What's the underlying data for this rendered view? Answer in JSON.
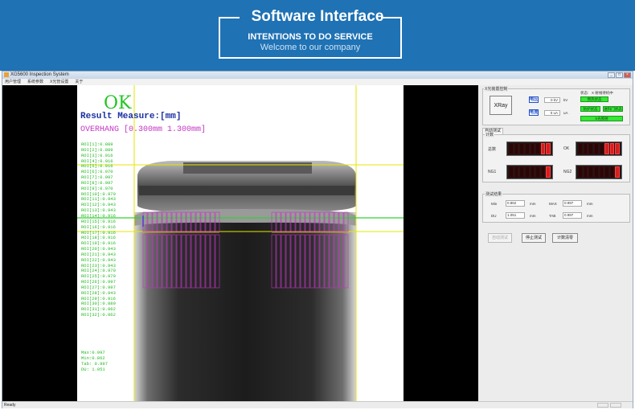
{
  "banner": {
    "title": "Software Interface",
    "subtitle": "INTENTIONS TO DO SERVICE",
    "welcome": "Welcome to our company"
  },
  "window": {
    "title": "XG5600 Inspection System",
    "menu": [
      "用户管理",
      "系统参数",
      "X光管设置",
      "关于"
    ]
  },
  "overlay": {
    "result_status": "OK",
    "result_measure": "Result Measure:[mm]",
    "overhang": "OVERHANG [0.300mm  1.300mm]",
    "measurements": [
      "ROI[1]:0.889",
      "ROI[2]:0.889",
      "ROI[3]:0.916",
      "ROI[4]:0.916",
      "ROI[5]:0.916",
      "ROI[6]:0.970",
      "ROI[7]:0.997",
      "ROI[8]:0.997",
      "ROI[9]:0.970",
      "ROI[10]:0.970",
      "ROI[11]:0.943",
      "ROI[12]:0.943",
      "ROI[13]:0.943",
      "ROI[14]:0.916",
      "ROI[15]:0.916",
      "ROI[16]:0.916",
      "ROI[17]:0.916",
      "ROI[18]:0.916",
      "ROI[19]:0.916",
      "ROI[20]:0.943",
      "ROI[21]:0.943",
      "ROI[22]:0.943",
      "ROI[23]:0.943",
      "ROI[24]:0.970",
      "ROI[25]:0.970",
      "ROI[26]:0.997",
      "ROI[27]:0.997",
      "ROI[28]:0.943",
      "ROI[29]:0.916",
      "ROI[30]:0.889",
      "ROI[31]:0.862",
      "ROI[32]:0.862"
    ],
    "stats": [
      "Max:0.997",
      "Min:0.862",
      "Tab: 0.997",
      "DU: 1.051"
    ]
  },
  "panel": {
    "xray_group": "X光装置控制",
    "xray_button": "XRay",
    "voltage_label": "电压",
    "voltage_value": "0 kV",
    "voltage_unit": "kV",
    "current_label": "电流",
    "current_value": "0 uA",
    "current_unit": "uA",
    "status_label": "状态:",
    "status_value": "X 射线待机中",
    "btn_preheat": "预热状态",
    "btn_interlock": "防护状态",
    "btn_door": "进料门状态",
    "btn_ray": "X光照射",
    "auto_tab": "自动测试",
    "count_group": "计数",
    "total_label": "总数",
    "ok_label": "OK",
    "ng1_label": "NG1",
    "ng2_label": "NG2",
    "total_value": "11",
    "ok_value": "136",
    "ng1_value": "1",
    "ng2_value": "0",
    "result_group": "测试结果",
    "min_label": "Min",
    "min_value": "0.862",
    "max_label": "MAX",
    "max_value": "0.997",
    "du_label": "DU",
    "du_value": "1.051",
    "tab_label": "TAB",
    "tab_value": "0.997",
    "unit_mm": "mm",
    "btn_auto": "自动测试",
    "btn_stop": "停止测试",
    "btn_clear": "计数清零"
  },
  "statusbar": {
    "text": "Ready"
  },
  "colors": {
    "banner": "#1f72b4",
    "ok_green": "#22c522",
    "roi_magenta": "#c535c5",
    "guide_yellow": "#e6e600",
    "led_red": "#d51e1e"
  }
}
